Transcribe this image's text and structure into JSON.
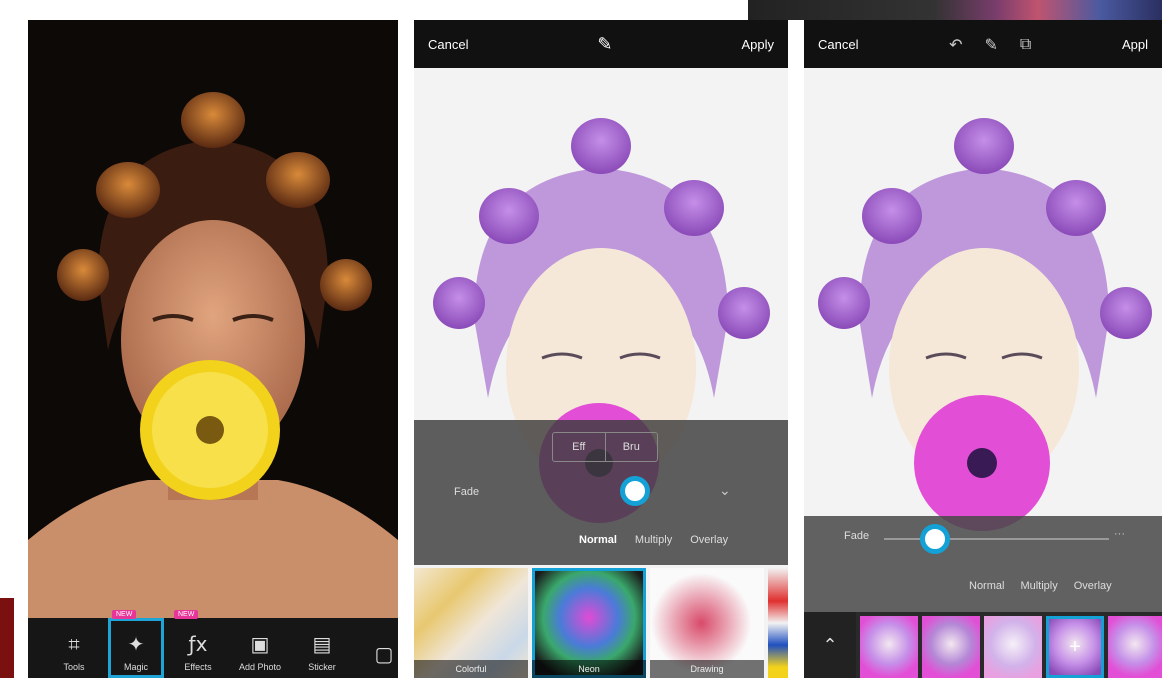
{
  "panel1": {
    "tools": [
      {
        "label": "Tools",
        "icon": "crop-icon",
        "badge": ""
      },
      {
        "label": "Magic",
        "icon": "magic-icon",
        "badge": "NEW"
      },
      {
        "label": "Effects",
        "icon": "effects-icon",
        "badge": "NEW"
      },
      {
        "label": "Add Photo",
        "icon": "add-photo-icon",
        "badge": ""
      },
      {
        "label": "Sticker",
        "icon": "sticker-icon",
        "badge": ""
      }
    ]
  },
  "panel2": {
    "cancel": "Cancel",
    "apply": "Apply",
    "brush_label": "Fade",
    "mode_tab_a": "Eff",
    "mode_tab_b": "Bru",
    "blend_modes": [
      "Normal",
      "Multiply",
      "Overlay"
    ],
    "thumbs": [
      "Colorful",
      "Neon",
      "Drawing"
    ]
  },
  "panel3": {
    "cancel": "Cancel",
    "apply": "Appl",
    "fade_label": "Fade",
    "blend_modes": [
      "Normal",
      "Multiply",
      "Overlay"
    ]
  },
  "colors": {
    "accent": "#14a1d6",
    "badge": "#e8359a",
    "hair_tint": "#a45bd0",
    "flower_yellow": "#f2d21b",
    "flower_pink": "#e24fd6"
  }
}
